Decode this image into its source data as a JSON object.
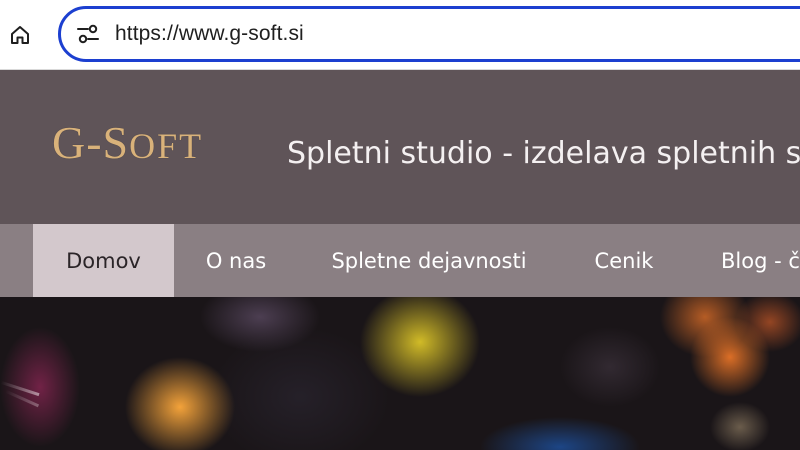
{
  "browser": {
    "url": "https://www.g-soft.si",
    "icons": {
      "home": "home-icon",
      "site_info": "site-info-icon"
    },
    "colors": {
      "address_bar_border": "#1c3fd0"
    }
  },
  "site": {
    "logo_text": "G-Soft",
    "tagline": "Spletni studio - izdelava spletnih strani",
    "colors": {
      "header_bg": "#5f5458",
      "logo": "#d9b27a",
      "nav_bg": "#8a7f83",
      "nav_active_bg": "#d3c8cc"
    }
  },
  "nav": {
    "items": [
      {
        "label": "Domov",
        "active": true
      },
      {
        "label": "O nas",
        "active": false
      },
      {
        "label": "Spletne dejavnosti",
        "active": false
      },
      {
        "label": "Cenik",
        "active": false
      },
      {
        "label": "Blog - članki",
        "active": false
      }
    ]
  }
}
